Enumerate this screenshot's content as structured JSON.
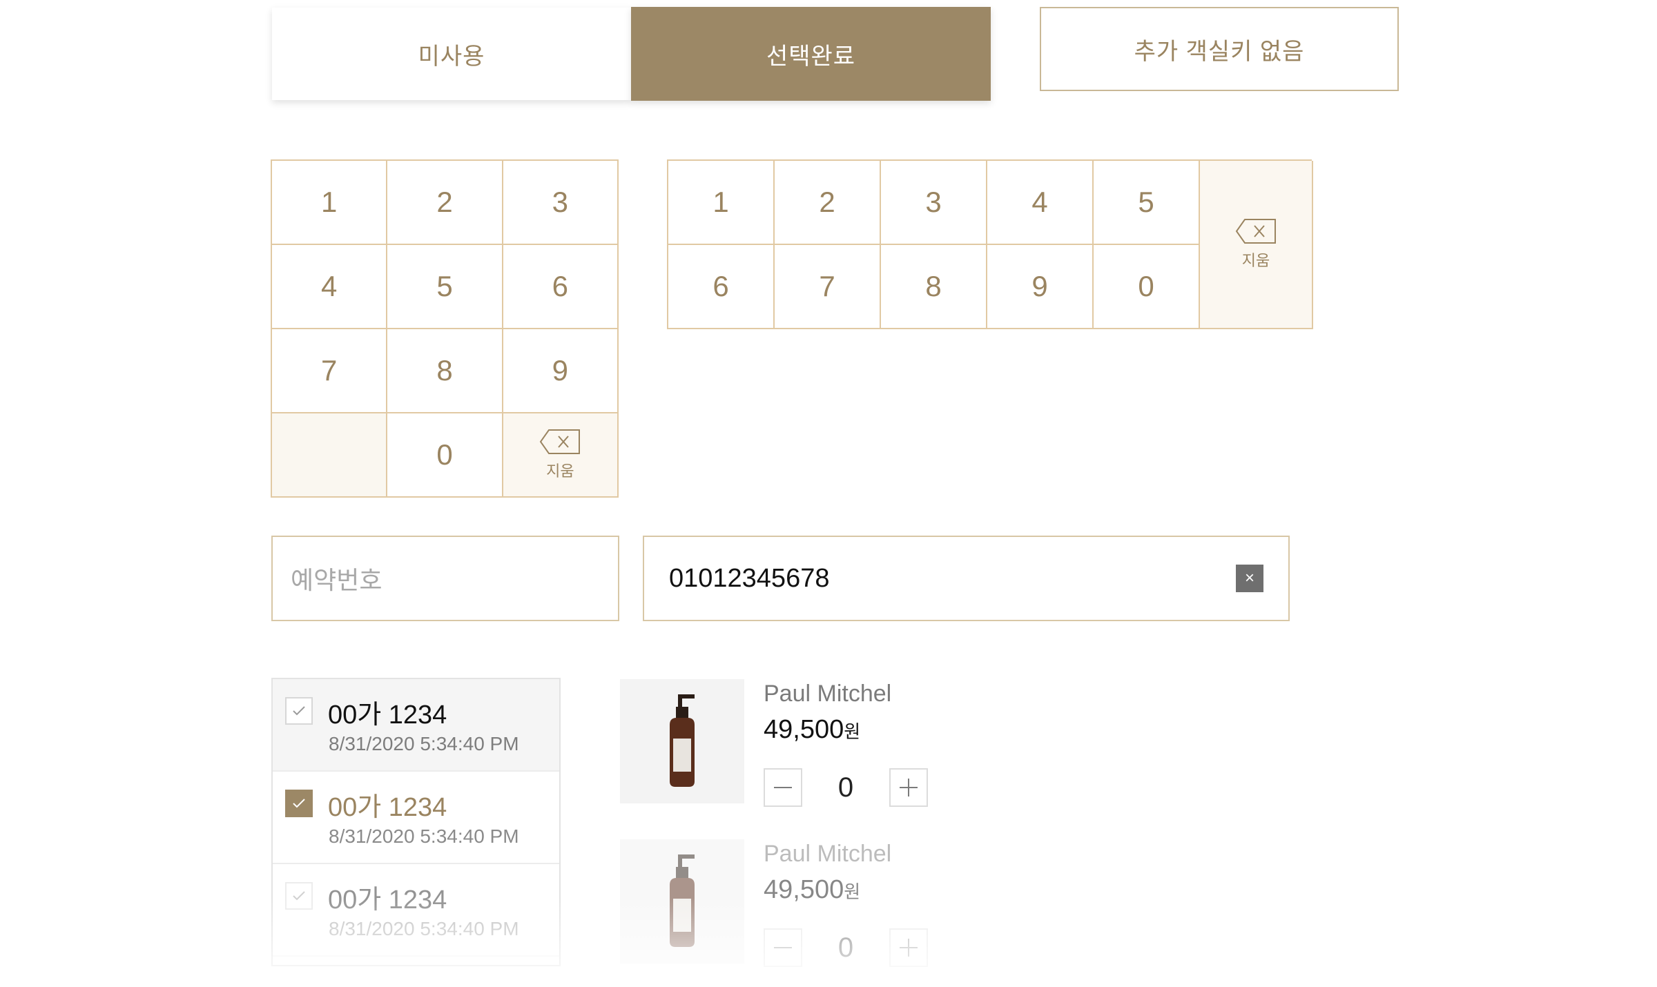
{
  "tabs": {
    "unused": "미사용",
    "selected": "선택완료",
    "no_extra_key": "추가 객실키 없음"
  },
  "keypad_small": {
    "keys": [
      "1",
      "2",
      "3",
      "4",
      "5",
      "6",
      "7",
      "8",
      "9",
      "",
      "0"
    ],
    "delete_label": "지움"
  },
  "keypad_wide": {
    "keys": [
      "1",
      "2",
      "3",
      "4",
      "5",
      "6",
      "7",
      "8",
      "9",
      "0"
    ],
    "delete_label": "지움"
  },
  "inputs": {
    "reservation_placeholder": "예약번호",
    "phone_value": "01012345678",
    "clear_symbol": "×"
  },
  "vehicles": [
    {
      "plate": "00가 1234",
      "time": "8/31/2020 5:34:40 PM",
      "checked": false
    },
    {
      "plate": "00가 1234",
      "time": "8/31/2020 5:34:40 PM",
      "checked": true
    },
    {
      "plate": "00가 1234",
      "time": "8/31/2020 5:34:40 PM",
      "checked": false
    }
  ],
  "products": [
    {
      "brand": "Paul Mitchel",
      "price": "49,500",
      "currency": "원",
      "qty": "0"
    },
    {
      "brand": "Paul Mitchel",
      "price": "49,500",
      "currency": "원",
      "qty": "0"
    }
  ],
  "icons": {
    "check": "check-icon",
    "minus": "minus-icon",
    "plus": "plus-icon",
    "backspace": "backspace-icon",
    "product": "pump-bottle-icon"
  },
  "colors": {
    "accent": "#9c8866",
    "accent_text": "#9a8460",
    "keypad_border": "#e1c9a3"
  }
}
